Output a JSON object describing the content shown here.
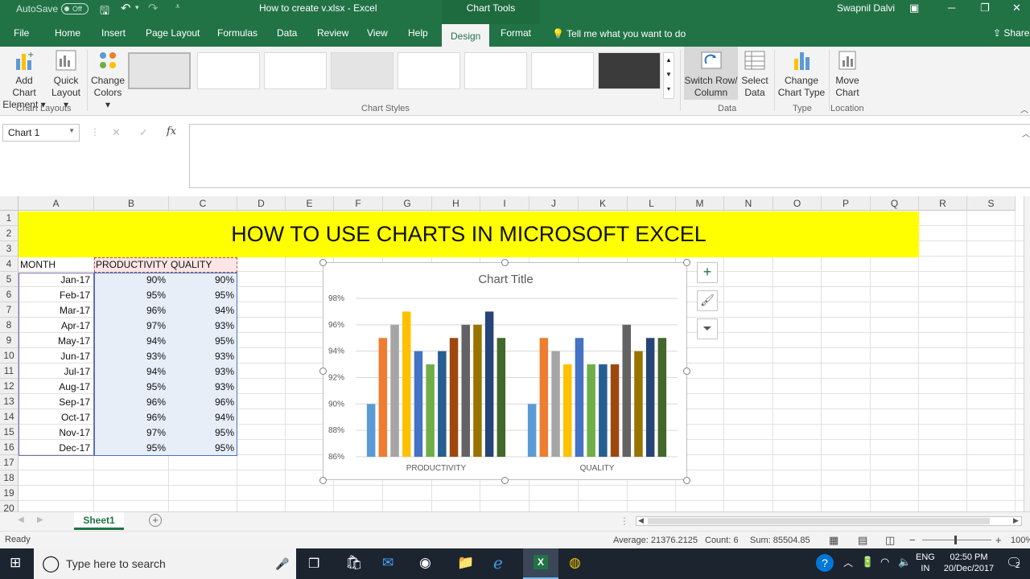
{
  "titlebar": {
    "autosave_label": "AutoSave",
    "autosave_state": "Off",
    "doc_title": "How to create v.xlsx  -  Excel",
    "context_tab": "Chart Tools",
    "user": "Swapnil Dalvi"
  },
  "tabs": [
    "File",
    "Home",
    "Insert",
    "Page Layout",
    "Formulas",
    "Data",
    "Review",
    "View",
    "Help",
    "Design",
    "Format"
  ],
  "tell_me": "Tell me what you want to do",
  "share": "Share",
  "ribbon": {
    "add_chart_element": [
      "Add Chart",
      "Element"
    ],
    "quick_layout": [
      "Quick",
      "Layout"
    ],
    "change_colors": [
      "Change",
      "Colors"
    ],
    "switch_row_col": [
      "Switch Row/",
      "Column"
    ],
    "select_data": [
      "Select",
      "Data"
    ],
    "change_chart_type": [
      "Change",
      "Chart Type"
    ],
    "move_chart": [
      "Move",
      "Chart"
    ],
    "groups": {
      "layouts": "Chart Layouts",
      "styles": "Chart Styles",
      "data": "Data",
      "type": "Type",
      "location": "Location"
    }
  },
  "formula_bar": {
    "name_box": "Chart 1",
    "fx": "fx"
  },
  "columns": [
    "A",
    "B",
    "C",
    "D",
    "E",
    "F",
    "G",
    "H",
    "I",
    "J",
    "K",
    "L",
    "M",
    "N",
    "O",
    "P",
    "Q",
    "R",
    "S"
  ],
  "rows": [
    "1",
    "2",
    "3",
    "4",
    "5",
    "6",
    "7",
    "8",
    "9",
    "10",
    "11",
    "12",
    "13",
    "14",
    "15",
    "16",
    "17",
    "18",
    "19",
    "20"
  ],
  "sheet": {
    "banner": "HOW TO USE CHARTS IN MICROSOFT EXCEL",
    "headers": [
      "MONTH",
      "PRODUCTIVITY",
      "QUALITY"
    ],
    "data": [
      [
        "Jan-17",
        "90%",
        "90%"
      ],
      [
        "Feb-17",
        "95%",
        "95%"
      ],
      [
        "Mar-17",
        "96%",
        "94%"
      ],
      [
        "Apr-17",
        "97%",
        "93%"
      ],
      [
        "May-17",
        "94%",
        "95%"
      ],
      [
        "Jun-17",
        "93%",
        "93%"
      ],
      [
        "Jul-17",
        "94%",
        "93%"
      ],
      [
        "Aug-17",
        "95%",
        "93%"
      ],
      [
        "Sep-17",
        "96%",
        "96%"
      ],
      [
        "Oct-17",
        "96%",
        "94%"
      ],
      [
        "Nov-17",
        "97%",
        "95%"
      ],
      [
        "Dec-17",
        "95%",
        "95%"
      ]
    ]
  },
  "chart_data": {
    "type": "bar",
    "title": "Chart Title",
    "categories": [
      "PRODUCTIVITY",
      "QUALITY"
    ],
    "ylim": [
      86,
      98
    ],
    "yticks": [
      "86%",
      "88%",
      "90%",
      "92%",
      "94%",
      "96%",
      "98%"
    ],
    "series": [
      {
        "name": "Jan-17",
        "values": [
          90,
          90
        ],
        "color": "#5b9bd5"
      },
      {
        "name": "Feb-17",
        "values": [
          95,
          95
        ],
        "color": "#ed7d31"
      },
      {
        "name": "Mar-17",
        "values": [
          96,
          94
        ],
        "color": "#a5a5a5"
      },
      {
        "name": "Apr-17",
        "values": [
          97,
          93
        ],
        "color": "#ffc000"
      },
      {
        "name": "May-17",
        "values": [
          94,
          95
        ],
        "color": "#4472c4"
      },
      {
        "name": "Jun-17",
        "values": [
          93,
          93
        ],
        "color": "#70ad47"
      },
      {
        "name": "Jul-17",
        "values": [
          94,
          93
        ],
        "color": "#255e91"
      },
      {
        "name": "Aug-17",
        "values": [
          95,
          93
        ],
        "color": "#9e480e"
      },
      {
        "name": "Sep-17",
        "values": [
          96,
          96
        ],
        "color": "#636363"
      },
      {
        "name": "Oct-17",
        "values": [
          96,
          94
        ],
        "color": "#997300"
      },
      {
        "name": "Nov-17",
        "values": [
          97,
          95
        ],
        "color": "#264478"
      },
      {
        "name": "Dec-17",
        "values": [
          95,
          95
        ],
        "color": "#43682b"
      }
    ],
    "grid": true,
    "legend": "none"
  },
  "sheet_tab": "Sheet1",
  "status": {
    "ready": "Ready",
    "average": "Average: 21376.2125",
    "count": "Count: 6",
    "sum": "Sum: 85504.85",
    "zoom": "100%"
  },
  "taskbar": {
    "search": "Type here to search",
    "lang": [
      "ENG",
      "IN"
    ],
    "time": "02:50 PM",
    "date": "20/Dec/2017",
    "notifications": "2"
  },
  "colors": {
    "excel_green": "#217346",
    "banner_yellow": "#ffff00"
  }
}
